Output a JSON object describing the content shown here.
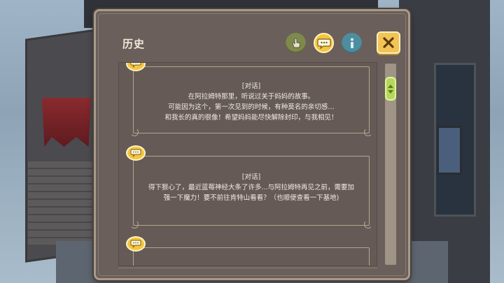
{
  "panel": {
    "title": "历史"
  },
  "toolbar": {
    "hand_icon": "hand-pointer-icon",
    "chat_icon": "speech-bubble-icon",
    "info_icon": "info-icon",
    "close_icon": "close-x-icon"
  },
  "entries": [
    {
      "tag": "[对话]",
      "lines": [
        "在阿拉姆特那里，听说过关于妈妈的故事。",
        "可能因为这个，第一次见到的时候，有种莫名的亲切感…",
        "和我长的真的很像！希望妈妈能尽快解除封印，与我相见！"
      ]
    },
    {
      "tag": "[对话]",
      "lines": [
        "得下狠心了，最近蓝莓神经大条了许多...与阿拉姆特再见之前，需要加",
        "强一下魔力！要不前往肯特山看看？（也顺便查看一下基地)"
      ]
    }
  ],
  "colors": {
    "panel_bg": "#6a5f5a",
    "accent_yellow": "#f4c63f",
    "scroll_green": "#b6d85a",
    "text": "#f3ece3"
  }
}
